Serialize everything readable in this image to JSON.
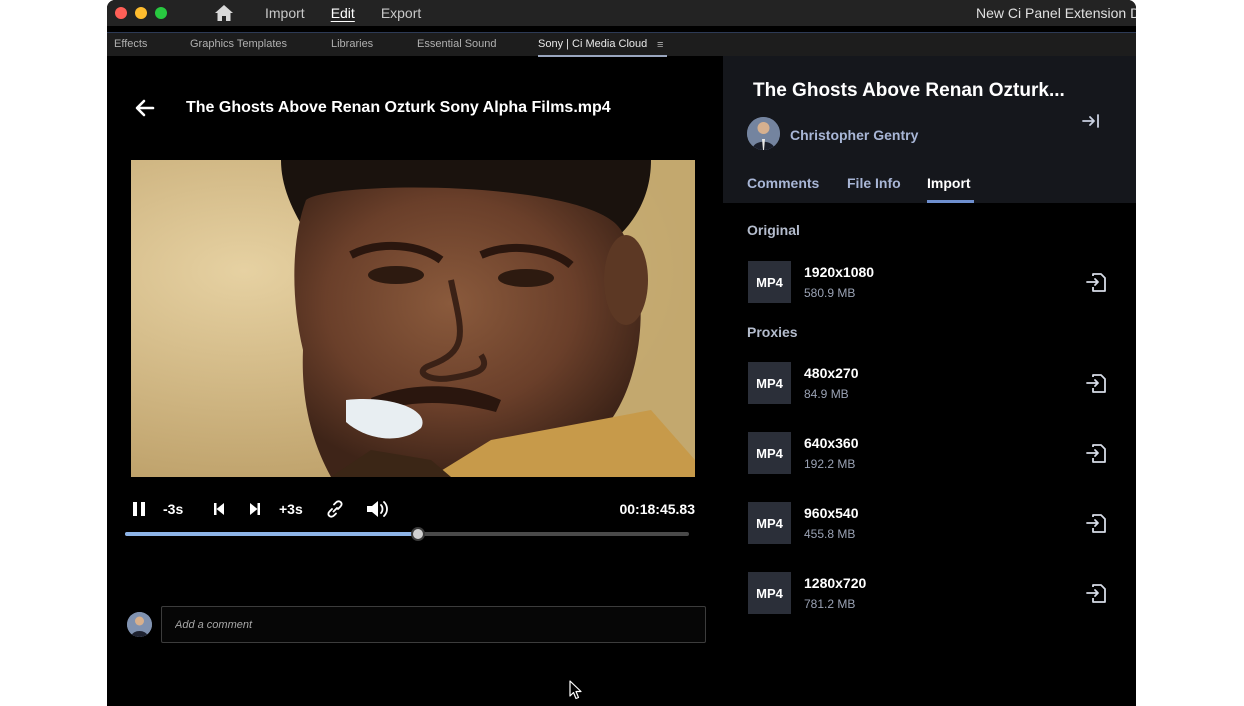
{
  "menubar": {
    "items": [
      "Import",
      "Edit",
      "Export"
    ],
    "active": "Edit",
    "app_title": "New Ci Panel Extension De"
  },
  "panel_tabs": [
    "Effects",
    "Graphics Templates",
    "Libraries",
    "Essential Sound",
    "Sony | Ci Media Cloud"
  ],
  "player": {
    "title": "The Ghosts Above Renan Ozturk Sony Alpha Films.mp4",
    "skip_back_label": "-3s",
    "skip_fwd_label": "+3s",
    "timecode": "00:18:45.83",
    "progress_fraction": 0.52,
    "comment_placeholder": "Add a comment"
  },
  "details": {
    "title": "The Ghosts Above Renan Ozturk...",
    "owner": "Christopher Gentry",
    "tabs": [
      "Comments",
      "File Info",
      "Import"
    ],
    "active_tab": "Import",
    "original_label": "Original",
    "proxies_label": "Proxies",
    "original": [
      {
        "format": "MP4",
        "resolution": "1920x1080",
        "size": "580.9 MB"
      }
    ],
    "proxies": [
      {
        "format": "MP4",
        "resolution": "480x270",
        "size": "84.9 MB"
      },
      {
        "format": "MP4",
        "resolution": "640x360",
        "size": "192.2 MB"
      },
      {
        "format": "MP4",
        "resolution": "960x540",
        "size": "455.8 MB"
      },
      {
        "format": "MP4",
        "resolution": "1280x720",
        "size": "781.2 MB"
      }
    ]
  },
  "colors": {
    "accent": "#6e8fcf",
    "progress": "#8db4e8",
    "panel_bg": "#15171c"
  }
}
